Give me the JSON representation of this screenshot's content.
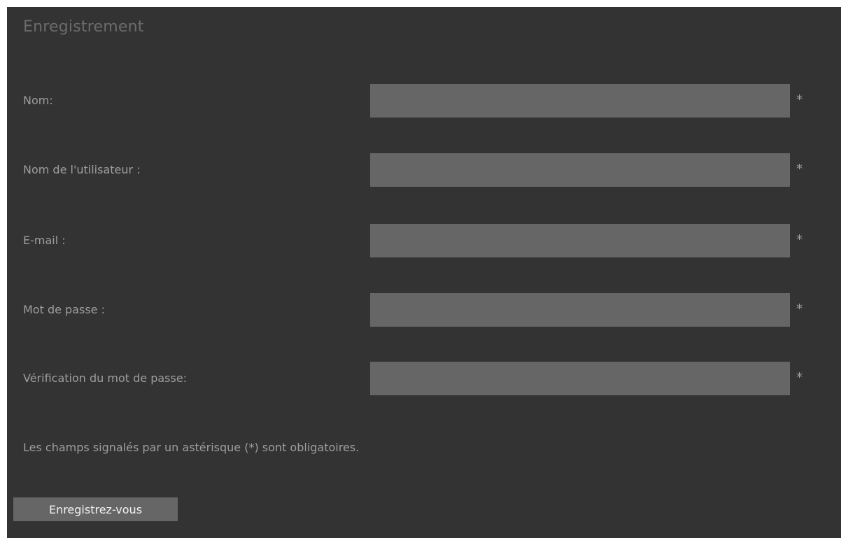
{
  "form": {
    "title": "Enregistrement",
    "fields": [
      {
        "label": "Nom:",
        "value": "",
        "required_mark": "*"
      },
      {
        "label": "Nom de l'utilisateur :",
        "value": "",
        "required_mark": "*"
      },
      {
        "label": "E-mail :",
        "value": "",
        "required_mark": "*"
      },
      {
        "label": "Mot de passe :",
        "value": "",
        "required_mark": "*"
      },
      {
        "label": "Vérification du mot de passe:",
        "value": "",
        "required_mark": "*"
      }
    ],
    "required_note": "Les champs signalés par un astérisque (*) sont obligatoires.",
    "submit_label": "Enregistrez-vous"
  },
  "colors": {
    "page_background": "#ffffff",
    "panel_background": "#333333",
    "input_background": "#666666",
    "label_text": "#9e9e9e",
    "title_text": "#6b6b6b",
    "button_text": "#f2f2f2"
  }
}
